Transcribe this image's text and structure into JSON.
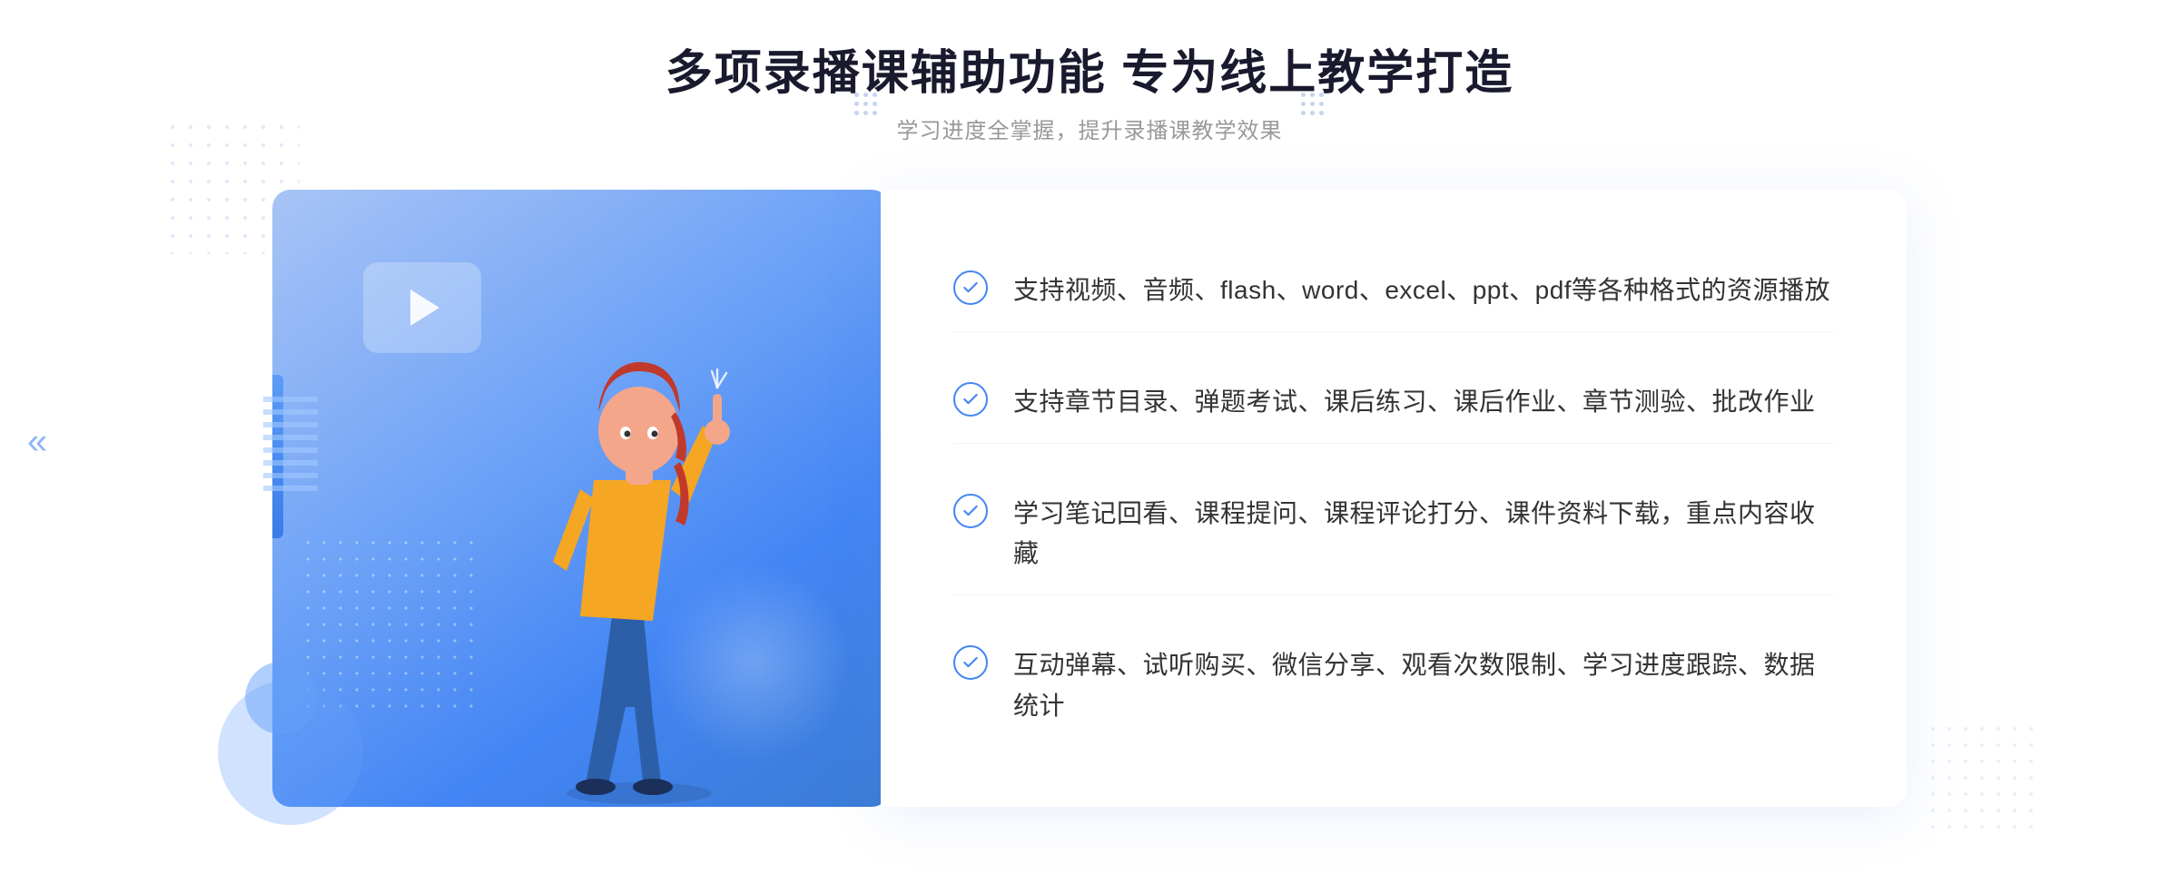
{
  "header": {
    "title": "多项录播课辅助功能 专为线上教学打造",
    "subtitle": "学习进度全掌握，提升录播课教学效果"
  },
  "features": [
    {
      "id": "feature-1",
      "text": "支持视频、音频、flash、word、excel、ppt、pdf等各种格式的资源播放"
    },
    {
      "id": "feature-2",
      "text": "支持章节目录、弹题考试、课后练习、课后作业、章节测验、批改作业"
    },
    {
      "id": "feature-3",
      "text": "学习笔记回看、课程提问、课程评论打分、课件资料下载，重点内容收藏"
    },
    {
      "id": "feature-4",
      "text": "互动弹幕、试听购买、微信分享、观看次数限制、学习进度跟踪、数据统计"
    }
  ],
  "colors": {
    "primary": "#4285f4",
    "title": "#1a1a2e",
    "subtitle": "#999999",
    "featureText": "#333333",
    "checkBorder": "#4285f4"
  },
  "decoration": {
    "leftArrow": "«"
  }
}
